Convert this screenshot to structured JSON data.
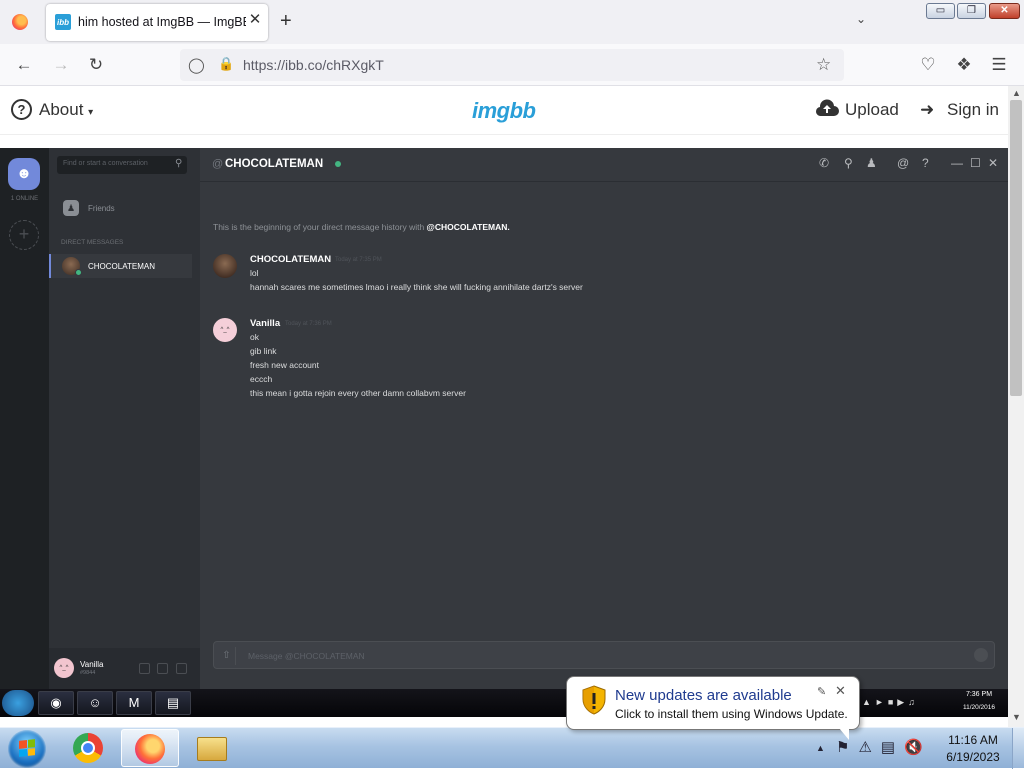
{
  "browser": {
    "tab_title": "him hosted at ImgBB — ImgBB",
    "tab_favicon": "ibb",
    "url": "https://ibb.co/chRXgkT",
    "new_tab": "+",
    "tab_close": "✕",
    "window": {
      "minimize": "▭",
      "maximize": "❐",
      "close": "✕"
    }
  },
  "site": {
    "about_label": "About",
    "logo": "imgbb",
    "upload_label": "Upload",
    "signin_label": "Sign in",
    "accent": "#2a9fd8"
  },
  "discord": {
    "online_count": "1 ONLINE",
    "search_placeholder": "Find or start a conversation",
    "friends_label": "Friends",
    "dm_header": "DIRECT MESSAGES",
    "dm_name": "CHOCOLATEMAN",
    "channel_at": "@",
    "channel_name": "CHOCOLATEMAN",
    "history_intro_prefix": "This is the beginning of your direct message history with ",
    "history_intro_user": "@CHOCOLATEMAN.",
    "messages": [
      {
        "author": "CHOCOLATEMAN",
        "time": "Today at 7:35 PM",
        "lines": [
          "lol",
          "hannah scares me sometimes lmao i really think she will fucking annihilate dartz's server"
        ]
      },
      {
        "author": "Vanilla",
        "time": "Today at 7:36 PM",
        "lines": [
          "ok",
          "gib link",
          "fresh new account",
          "eccch",
          "this mean i gotta rejoin every other damn collabvm server"
        ]
      }
    ],
    "input_placeholder": "Message @CHOCOLATEMAN",
    "user_name": "Vanilla",
    "user_tag": "#9844",
    "online_color": "#43b581",
    "blurple": "#7289da"
  },
  "inner_taskbar": {
    "time": "7:36 PM",
    "date": "11/20/2016"
  },
  "balloon": {
    "title": "New updates are available",
    "message": "Click to install them using Windows Update.",
    "icon": "shield-warning-icon"
  },
  "taskbar": {
    "time": "11:16 AM",
    "date": "6/19/2023",
    "apps": [
      "chrome-icon",
      "firefox-icon",
      "explorer-icon"
    ]
  }
}
